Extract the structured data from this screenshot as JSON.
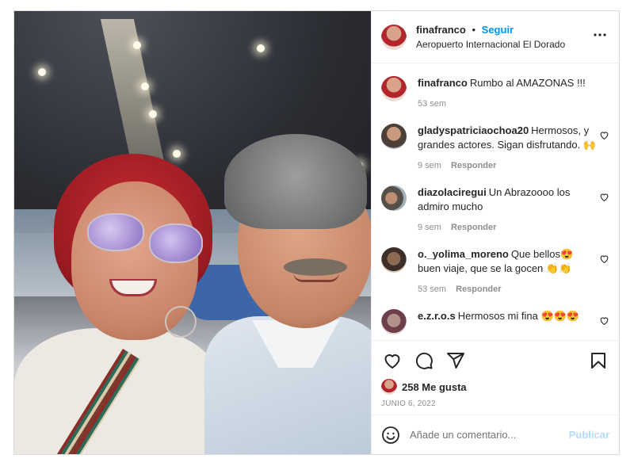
{
  "post": {
    "username": "finafranco",
    "separator": "•",
    "follow_label": "Seguir",
    "location": "Aeropuerto Internacional El Dorado",
    "more_label": "•••"
  },
  "caption": {
    "username": "finafranco",
    "text": "Rumbo al AMAZONAS !!!",
    "time": "53 sem"
  },
  "comments": [
    {
      "username": "gladyspatriciaochoa20",
      "text": "Hermosos, y grandes actores. Sigan disfrutando. 🙌",
      "time": "9 sem",
      "reply": "Responder"
    },
    {
      "username": "diazolaciregui",
      "text": "Un Abrazoooo los admiro mucho",
      "time": "9 sem",
      "reply": "Responder"
    },
    {
      "username": "o._yolima_moreno",
      "text": "Que bellos😍 buen viaje, que se la gocen 👏👏",
      "time": "53 sem",
      "reply": "Responder"
    },
    {
      "username": "e.z.r.o.s",
      "text": "Hermosos mi fina 😍😍😍",
      "time": "",
      "reply": ""
    }
  ],
  "likes": {
    "count_label": "258 Me gusta"
  },
  "date": "JUNIO 6, 2022",
  "add_comment": {
    "placeholder": "Añade un comentario...",
    "publish_label": "Publicar"
  },
  "colors": {
    "accent": "#0095f6",
    "publish_disabled": "#b3dbff",
    "muted": "#8e8e8e",
    "text": "#262626"
  },
  "icons": [
    "more-icon",
    "heart-icon",
    "comment-icon",
    "share-icon",
    "bookmark-icon",
    "emoji-icon"
  ]
}
